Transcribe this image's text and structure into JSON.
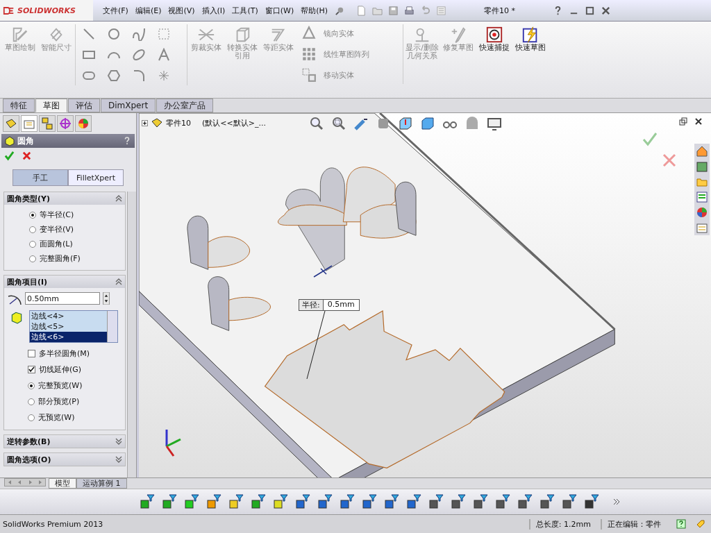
{
  "app": {
    "logo": "SOLIDWORKS",
    "menu": [
      "文件(F)",
      "编辑(E)",
      "视图(V)",
      "插入(I)",
      "工具(T)",
      "窗口(W)",
      "帮助(H)"
    ],
    "document_title": "零件10 *"
  },
  "ribbon": [
    {
      "kind": "large",
      "label": "草图绘制",
      "disabled": true
    },
    {
      "kind": "large",
      "label": "智能尺寸",
      "disabled": true
    },
    {
      "kind": "grid"
    },
    {
      "kind": "large",
      "label": "剪裁实体",
      "disabled": true
    },
    {
      "kind": "large",
      "label": "转换实体引用",
      "disabled": true
    },
    {
      "kind": "large",
      "label": "等距实体",
      "disabled": true
    },
    {
      "kind": "rows",
      "items": [
        {
          "label": "镜向实体",
          "disabled": true
        },
        {
          "label": "线性草图阵列",
          "disabled": true
        },
        {
          "label": "移动实体",
          "disabled": true
        }
      ]
    },
    {
      "kind": "large",
      "label": "显示/删除几何关系",
      "disabled": true
    },
    {
      "kind": "large",
      "label": "修复草图",
      "disabled": true
    },
    {
      "kind": "large",
      "label": "快速捕捉",
      "disabled": false
    },
    {
      "kind": "large",
      "label": "快速草图",
      "disabled": false
    }
  ],
  "tabs": [
    {
      "label": "特征",
      "selected": false
    },
    {
      "label": "草图",
      "selected": true
    },
    {
      "label": "评估",
      "selected": false
    },
    {
      "label": "DimXpert",
      "selected": false
    },
    {
      "label": "办公室产品",
      "selected": false
    }
  ],
  "tree": {
    "name": "零件10",
    "configuration": "(默认<<默认>_..."
  },
  "property_manager": {
    "title": "圆角",
    "modes": [
      {
        "label": "手工",
        "selected": true
      },
      {
        "label": "FilletXpert",
        "selected": false
      }
    ],
    "sections": [
      {
        "title": "圆角类型(Y)",
        "expanded": true,
        "options": [
          {
            "kind": "radio",
            "label": "等半径(C)",
            "selected": true
          },
          {
            "kind": "radio",
            "label": "变半径(V)",
            "selected": false
          },
          {
            "kind": "radio",
            "label": "面圆角(L)",
            "selected": false
          },
          {
            "kind": "radio",
            "label": "完整圆角(F)",
            "selected": false
          }
        ]
      },
      {
        "title": "圆角项目(I)",
        "expanded": true,
        "radius": "0.50mm",
        "edges": [
          {
            "label": "边线<4>",
            "selected": false
          },
          {
            "label": "边线<5>",
            "selected": false
          },
          {
            "label": "边线<6>",
            "selected": true
          }
        ],
        "options": [
          {
            "kind": "checkbox",
            "label": "多半径圆角(M)",
            "checked": false
          },
          {
            "kind": "checkbox",
            "label": "切线延伸(G)",
            "checked": true
          },
          {
            "kind": "radio",
            "label": "完整预览(W)",
            "selected": true
          },
          {
            "kind": "radio",
            "label": "部分预览(P)",
            "selected": false
          },
          {
            "kind": "radio",
            "label": "无预览(W)",
            "selected": false
          }
        ]
      },
      {
        "title": "逆转参数(B)",
        "expanded": false
      },
      {
        "title": "圆角选项(O)",
        "expanded": false
      }
    ]
  },
  "dimension": {
    "label": "半径:",
    "value": "0.5mm"
  },
  "model_tabs": [
    {
      "label": "模型",
      "selected": true
    },
    {
      "label": "运动算例 1",
      "selected": false
    }
  ],
  "status_bar": {
    "product": "SolidWorks Premium 2013",
    "measure": "总长度: 1.2mm",
    "mode": "正在编辑：零件"
  }
}
